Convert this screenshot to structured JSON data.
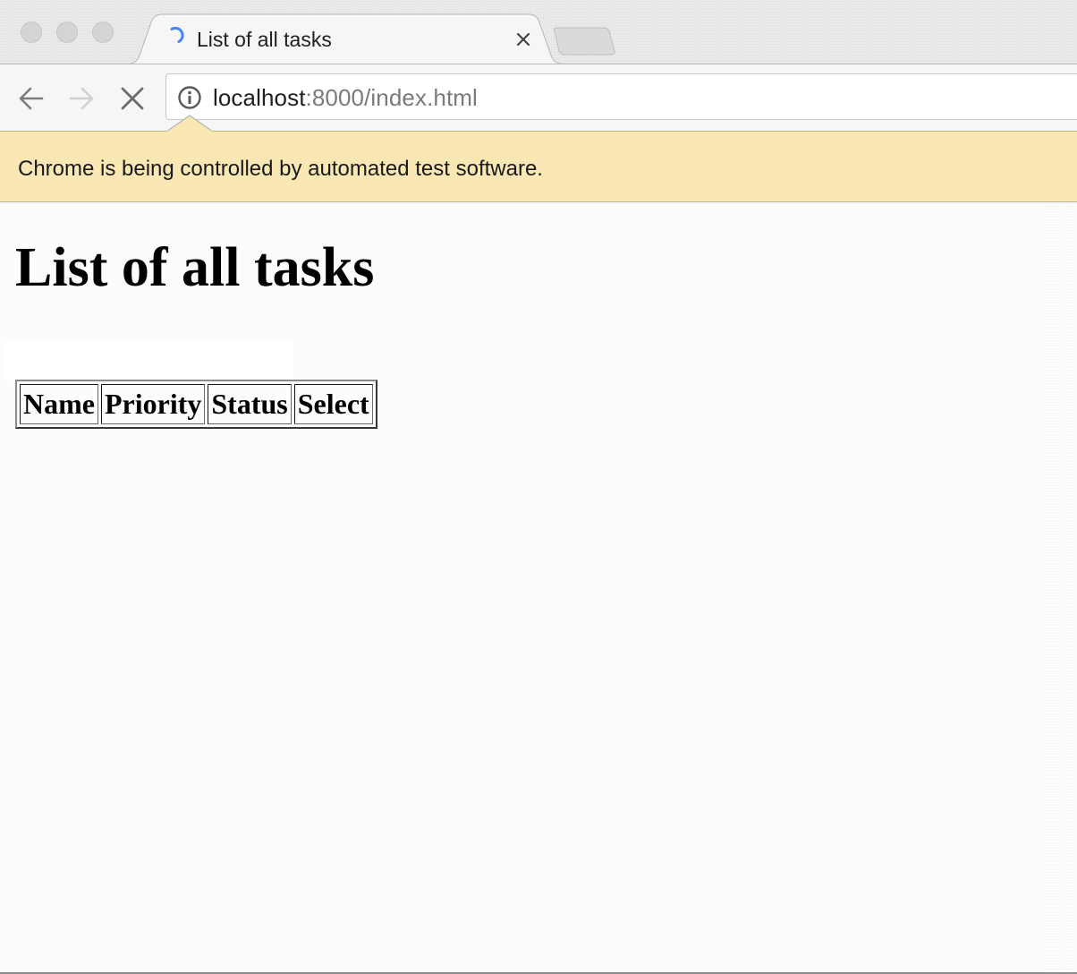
{
  "tab": {
    "title": "List of all tasks"
  },
  "address_bar": {
    "host": "localhost",
    "rest": ":8000/index.html"
  },
  "infobar": {
    "message": "Chrome is being controlled by automated test software."
  },
  "page": {
    "heading": "List of all tasks",
    "table": {
      "columns": [
        "Name",
        "Priority",
        "Status",
        "Select"
      ]
    }
  },
  "colors": {
    "infobar_bg": "#f9e7b4",
    "spinner": "#4285f4",
    "page_bg": "#fcfcfc"
  },
  "icons": {
    "back": "arrow-left",
    "forward": "arrow-right",
    "stop": "x",
    "site_info": "info-circle",
    "tab_close": "x",
    "loading": "spinner"
  }
}
